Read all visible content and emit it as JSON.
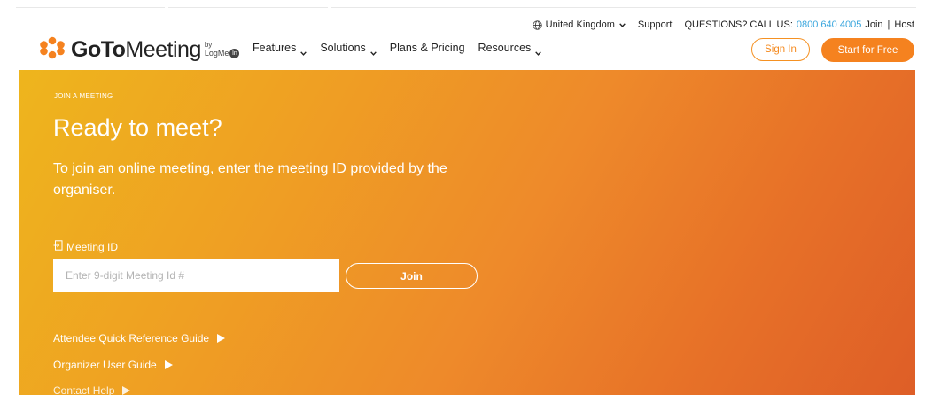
{
  "utility": {
    "region": "United Kingdom",
    "support": "Support",
    "questions": "QUESTIONS? CALL US:",
    "phone": "0800 640 4005",
    "join": "Join",
    "separator": "|",
    "host": "Host"
  },
  "logo": {
    "goto": "GoTo",
    "meeting": "Meeting",
    "by": "by",
    "logmein": "LogMe",
    "in": "In"
  },
  "nav": [
    {
      "label": "Features",
      "dropdown": true
    },
    {
      "label": "Solutions",
      "dropdown": true
    },
    {
      "label": "Plans & Pricing",
      "dropdown": false
    },
    {
      "label": "Resources",
      "dropdown": true
    }
  ],
  "header_buttons": {
    "sign_in": "Sign In",
    "start_free": "Start for Free"
  },
  "hero": {
    "kicker": "JOIN A MEETING",
    "headline": "Ready to meet?",
    "lede": "To join an online meeting, enter the meeting ID provided by the organiser.",
    "meeting_id_label": "Meeting ID",
    "meeting_id_placeholder": "Enter 9-digit Meeting Id #",
    "join_button": "Join",
    "links": [
      "Attendee Quick Reference Guide",
      "Organizer User Guide",
      "Contact Help"
    ]
  },
  "colors": {
    "brand_orange": "#f5821f",
    "phone_link": "#3aa6dd",
    "hero_gradient_start": "#eeb51d",
    "hero_gradient_end": "#de5e27"
  }
}
